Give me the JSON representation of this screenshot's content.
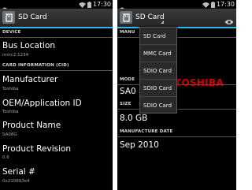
{
  "status": {
    "time": "17:30"
  },
  "left": {
    "title": "SD Card",
    "sections": {
      "device": "DEVICE",
      "card_info": "CARD INFORMATION (CID)"
    },
    "items": [
      {
        "label": "Bus Location",
        "value": "mmc2:1234"
      },
      {
        "label": "Manufacturer",
        "value": "Toshiba"
      },
      {
        "label": "OEM/Application ID",
        "value": "Toshiba"
      },
      {
        "label": "Product Name",
        "value": "SA08G"
      },
      {
        "label": "Product Revision",
        "value": "0.6"
      },
      {
        "label": "Serial #",
        "value": "0x210893e4"
      }
    ]
  },
  "right": {
    "title": "SD Card",
    "sections": {
      "manufacturer": "MANU",
      "model": "MODE",
      "size": "SIZE",
      "manufacture_date": "MANUFACTURE DATE"
    },
    "logo_text": "TOSHIBA",
    "model_value": "SA0",
    "size_value": "8.0 GB",
    "manufacture_date_value": "Sep 2010",
    "dropdown": [
      "SD Card",
      "MMC Card",
      "SDIO Card",
      "SDIO Card",
      "SDIO Card"
    ]
  },
  "colors": {
    "accent": "#33b5e5",
    "brand_red": "#cc0000",
    "background": "#000000"
  },
  "icons": [
    "android-debug-icon",
    "sd-card-icon",
    "wifi-icon",
    "battery-icon",
    "eye-icon"
  ]
}
